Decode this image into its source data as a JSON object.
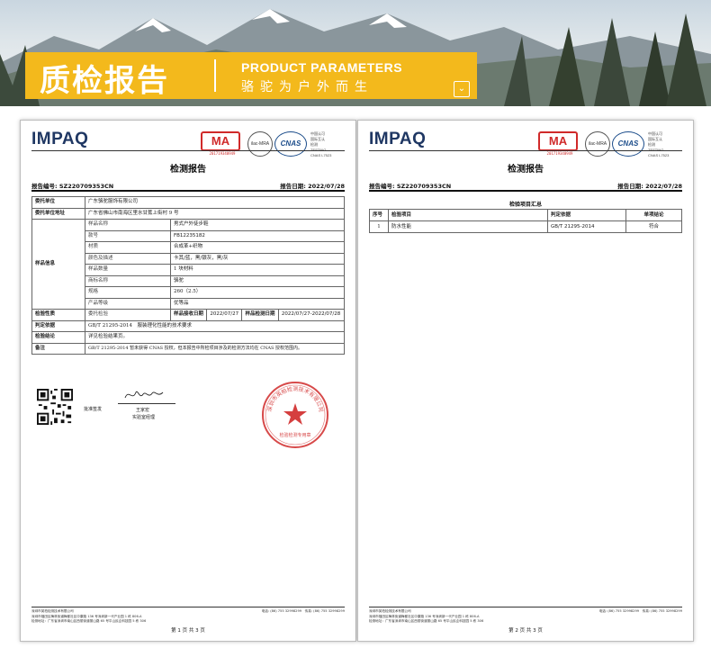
{
  "banner": {
    "title": "质检报告",
    "subtitle_en": "PRODUCT PARAMETERS",
    "subtitle_cn": "骆驼为户外而生",
    "button_icon": "chevron-down-icon"
  },
  "colors": {
    "banner_yellow": "#f3b91c",
    "logo_blue": "#1f3763",
    "stamp_red": "#d02a2a",
    "cnas_blue": "#1b4c8a"
  },
  "pages": [
    {
      "logo": "IMPAQ",
      "ma_label": "MA",
      "ma_number": "201719340949",
      "ilac_label": "ilac-MRA",
      "cnas_label": "CNAS",
      "cnas_text": [
        "中国认可",
        "国际互认",
        "检测",
        "TESTING",
        "CNAS L7523"
      ],
      "title": "检测报告",
      "report_no": "报告编号: SZ220709353CN",
      "report_date": "报告日期: 2022/07/28",
      "rows": {
        "client_label": "委托单位",
        "client": "广东骆驼服饰有限公司",
        "address_label": "委托单位地址",
        "address": "广东省佛山市南海区里水甘蕉上街村 9 号",
        "sample_label": "样品信息",
        "sample_fields": [
          {
            "k": "样品名称",
            "v": "男式户外徒步鞋"
          },
          {
            "k": "款号",
            "v": "FB12235182"
          },
          {
            "k": "材质",
            "v": "合成革+织物"
          },
          {
            "k": "颜色及描述",
            "v": "卡其/蓝，黑/银灰，黑/灰"
          },
          {
            "k": "样品数量",
            "v": "1 块材料"
          },
          {
            "k": "商标名称",
            "v": "骆驼"
          },
          {
            "k": "规格",
            "v": "260（2.5）"
          },
          {
            "k": "产品等级",
            "v": "优等品"
          }
        ],
        "test_type_label": "检验性质",
        "test_type": "委托检验",
        "received_label": "样品接收日期",
        "received": "2022/07/27",
        "test_date_label": "样品检测日期",
        "test_date": "2022/07/27-2022/07/28",
        "basis_label": "判定依据",
        "basis": "GB/T 21295-2014　服装理化性能的技术要求",
        "conclusion_label": "检验结论",
        "conclusion": "详见检验结果页。",
        "remark_label": "备注",
        "remark": "GB/T 21295-2014 暂未获得 CNAS 授权，但本报告中所检项目涉及的检测方法均在 CNAS 授权范围内。"
      },
      "approver_label": "批准签发",
      "approver_name": "王家宏",
      "approver_role": "实验室经理",
      "stamp_text": "深圳市英柏检测技术有限公司",
      "stamp_bottom": "检验检测专用章",
      "footer_lines": [
        "深圳市英柏检测技术有限公司",
        "深圳市福田区梅林街道梅都社区中康路 136 号深圳新一代产业园 1 栋 806-A",
        "检测地址：广东省深圳市南山区西丽街道丽山路 65 号平山民企科技园 5 栋 306"
      ],
      "footer_tel": "电话: (86) 755 32998299　传真: (86) 755 32998299",
      "page_no": "第 1 页 共 3 页"
    },
    {
      "logo": "IMPAQ",
      "ma_label": "MA",
      "ma_number": "201719340949",
      "ilac_label": "ilac-MRA",
      "cnas_label": "CNAS",
      "cnas_text": [
        "中国认可",
        "国际互认",
        "检测",
        "TESTING",
        "CNAS L7523"
      ],
      "title": "检测报告",
      "report_no": "报告编号: SZ220709353CN",
      "report_date": "报告日期: 2022/07/28",
      "summary_title": "检验项目汇总",
      "summary_headers": [
        "序号",
        "检验项目",
        "判定依据",
        "单项结论"
      ],
      "summary_rows": [
        {
          "no": "1",
          "item": "防水性能",
          "basis": "GB/T 21295-2014",
          "result": "符合"
        }
      ],
      "footer_lines": [
        "深圳市英柏检测技术有限公司",
        "深圳市福田区梅林街道梅都社区中康路 136 号深圳新一代产业园 1 栋 806-A",
        "检测地址：广东省深圳市南山区西丽街道丽山路 65 号平山民企科技园 5 栋 306"
      ],
      "footer_tel": "电话: (86) 755 32998299　传真: (86) 755 32998299",
      "page_no": "第 2 页 共 3 页"
    }
  ]
}
